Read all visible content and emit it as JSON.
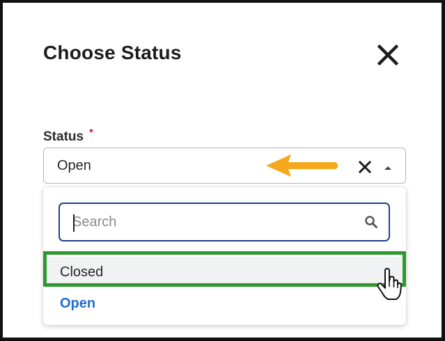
{
  "dialog": {
    "title": "Choose Status"
  },
  "status_field": {
    "label": "Status",
    "required_mark": "*",
    "value": "Open"
  },
  "dropdown": {
    "search_placeholder": "Search",
    "options": [
      {
        "label": "Closed",
        "hovered": true
      },
      {
        "label": "Open",
        "selected": true
      }
    ]
  },
  "icons": {
    "close": "close-icon",
    "clear": "clear-icon",
    "caret": "caret-up-icon",
    "search": "search-icon",
    "annotation_arrow": "left-arrow-icon",
    "pointer": "hand-pointer-icon"
  },
  "colors": {
    "accent_blue": "#1f6fd1",
    "focus_border": "#1f3f8c",
    "highlight_green": "#2e9a2e",
    "annotation_orange": "#f5a81c",
    "required_red": "#cc2222"
  }
}
